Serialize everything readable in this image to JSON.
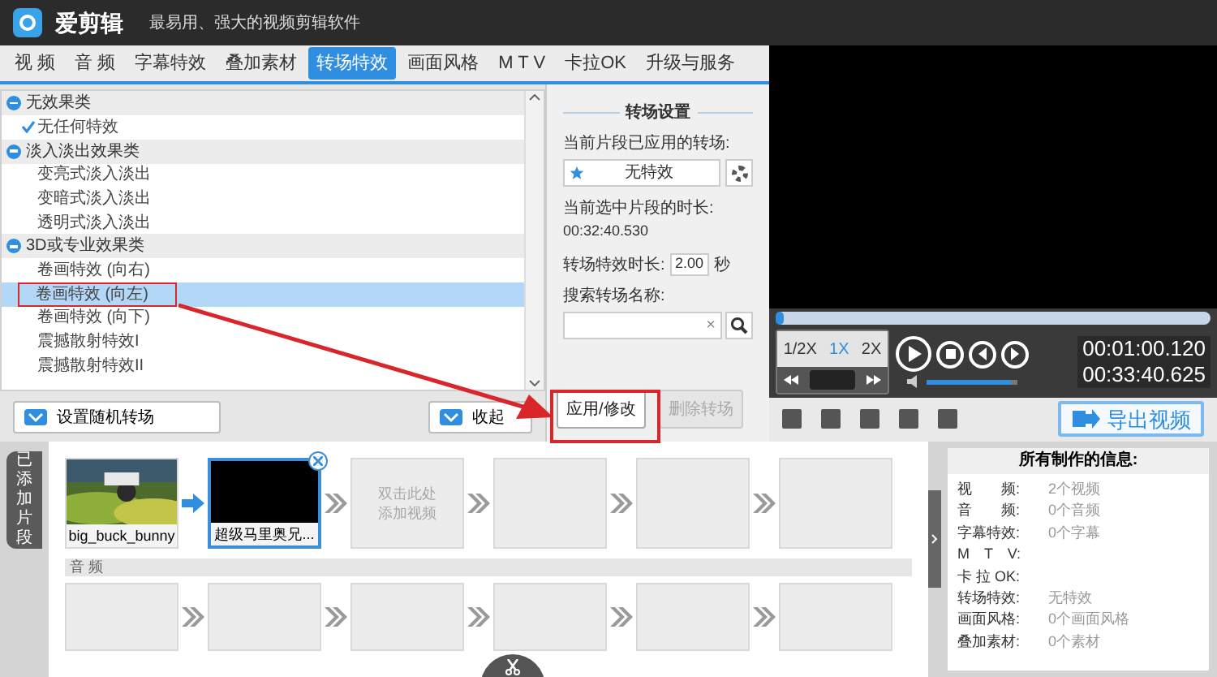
{
  "window": {
    "title": "爱剪辑",
    "subtitle": "最易用、强大的视频剪辑软件"
  },
  "tabs": [
    {
      "label": "视 频",
      "selected": false
    },
    {
      "label": "音 频",
      "selected": false
    },
    {
      "label": "字幕特效",
      "selected": false
    },
    {
      "label": "叠加素材",
      "selected": false
    },
    {
      "label": "转场特效",
      "selected": true
    },
    {
      "label": "画面风格",
      "selected": false
    },
    {
      "label": "M T V",
      "selected": false
    },
    {
      "label": "卡拉OK",
      "selected": false
    },
    {
      "label": "升级与服务",
      "selected": false
    }
  ],
  "effects": [
    {
      "label": "无效果类",
      "expanded": true,
      "children": [
        {
          "label": "无任何特效",
          "checked": true,
          "selected": false
        }
      ]
    },
    {
      "label": "淡入淡出效果类",
      "expanded": true,
      "children": [
        {
          "label": "变亮式淡入淡出",
          "checked": false,
          "selected": false
        },
        {
          "label": "变暗式淡入淡出",
          "checked": false,
          "selected": false
        },
        {
          "label": "透明式淡入淡出",
          "checked": false,
          "selected": false
        }
      ]
    },
    {
      "label": "3D或专业效果类",
      "expanded": true,
      "children": [
        {
          "label": "卷画特效 (向右)",
          "checked": false,
          "selected": false
        },
        {
          "label": "卷画特效 (向左)",
          "checked": false,
          "selected": true
        },
        {
          "label": "卷画特效 (向下)",
          "checked": false,
          "selected": false
        },
        {
          "label": "震撼散射特效I",
          "checked": false,
          "selected": false
        },
        {
          "label": "震撼散射特效II",
          "checked": false,
          "selected": false
        }
      ]
    }
  ],
  "list_buttons": [
    {
      "label": "设置随机转场",
      "kind": "random"
    },
    {
      "label": "收起",
      "kind": "collapse"
    }
  ],
  "settings": {
    "title": "转场设置",
    "applied_label": "当前片段已应用的转场:",
    "applied_value": "无特效",
    "duration_label": "当前选中片段的时长:",
    "duration_value": "00:32:40.530",
    "effect_duration_label": "转场特效时长:",
    "effect_duration_value": "2.00",
    "effect_duration_unit": "秒",
    "search_label": "搜索转场名称:",
    "clear": "×",
    "buttons": [
      {
        "label": "应用/修改",
        "disabled": false
      },
      {
        "label": "删除转场",
        "disabled": true
      }
    ]
  },
  "player": {
    "progress": {
      "level": 0.02
    },
    "speeds": [
      {
        "label": "1/2X",
        "selected": false
      },
      {
        "label": "1X",
        "selected": true
      },
      {
        "label": "2X",
        "selected": false
      }
    ],
    "current_time": "00:01:00.120",
    "total_time": "00:33:40.625",
    "volume": {
      "level": 0.92
    },
    "export_button": "导出视频"
  },
  "timeline": {
    "side_tab": "已添加片段",
    "video": [
      {
        "kind": "clip",
        "label": "big_buck_bunny",
        "selected": false
      },
      {
        "kind": "black",
        "label": "超级马里奥兄...",
        "selected": true
      },
      {
        "kind": "hint",
        "label": "双击此处添加视频",
        "selected": false
      },
      {
        "kind": "empty",
        "selected": false
      },
      {
        "kind": "empty",
        "selected": false
      },
      {
        "kind": "empty",
        "selected": false
      }
    ],
    "audio_label": "音 频"
  },
  "info": {
    "title": "所有制作的信息:",
    "rows": [
      {
        "label": "视　　频:",
        "value": "2个视频"
      },
      {
        "label": "音　　频:",
        "value": "0个音频"
      },
      {
        "label": "字幕特效:",
        "value": "0个字幕"
      },
      {
        "label": "M　T　V:"
      },
      {
        "label": "卡 拉 OK:"
      },
      {
        "label": "转场特效:",
        "value": "无特效"
      },
      {
        "label": "画面风格:",
        "value": "0个画面风格"
      },
      {
        "label": "叠加素材:",
        "value": "0个素材"
      }
    ]
  }
}
